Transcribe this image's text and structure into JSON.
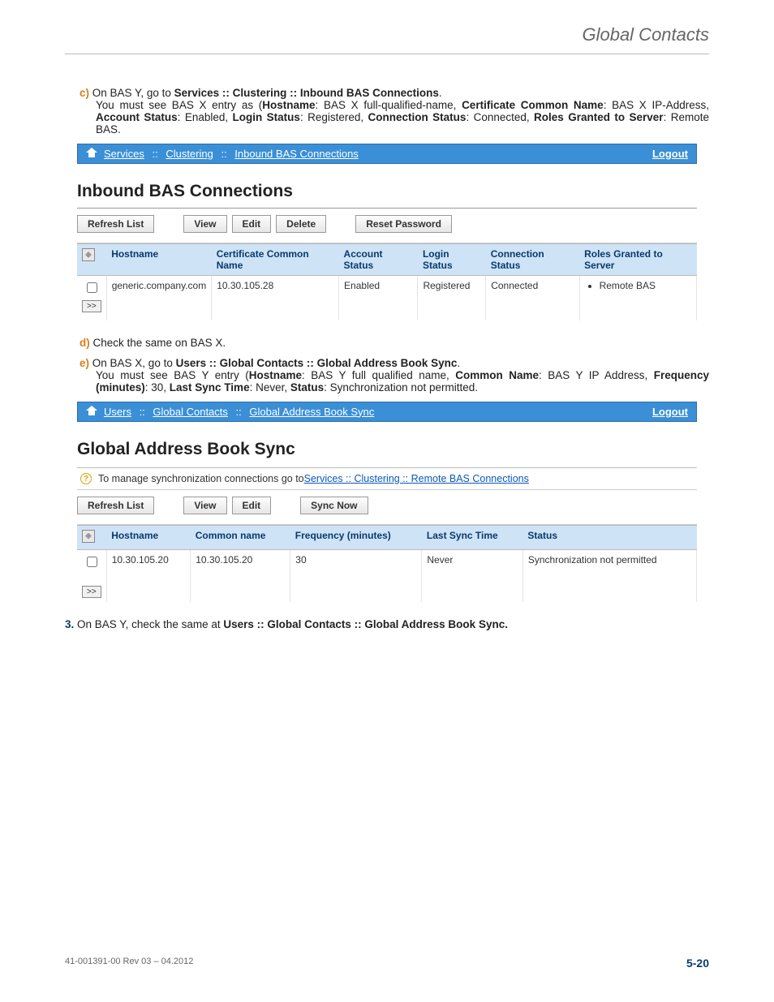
{
  "header_title": "Global Contacts",
  "step_c": {
    "label": "c)",
    "intro_pre": "On BAS Y, go to ",
    "intro_bold": "Services :: Clustering :: Inbound BAS Connections",
    "intro_post": ".",
    "body_parts": [
      "You must see BAS X entry as (",
      {
        "b": "Hostname"
      },
      ": BAS X full-qualified-name, ",
      {
        "b": "Certificate Common Name"
      },
      ": BAS X IP-Address, ",
      {
        "b": "Account Status"
      },
      ": Enabled, ",
      {
        "b": "Login Status"
      },
      ": Registered, ",
      {
        "b": "Connection Status"
      },
      ": Connected, ",
      {
        "b": "Roles Granted to Server"
      },
      ": Remote BAS."
    ]
  },
  "bar1": {
    "crumbs": [
      "Services",
      "Clustering",
      "Inbound BAS Connections"
    ],
    "sep": "::",
    "logout": "Logout"
  },
  "panel1": {
    "title": "Inbound BAS Connections",
    "buttons": [
      "Refresh List",
      "View",
      "Edit",
      "Delete",
      "Reset Password"
    ],
    "columns": [
      "Hostname",
      "Certificate Common Name",
      "Account Status",
      "Login Status",
      "Connection Status",
      "Roles Granted to Server"
    ],
    "rows": [
      {
        "hostname": "generic.company.com",
        "ccn": "10.30.105.28",
        "account_status": "Enabled",
        "login_status": "Registered",
        "connection_status": "Connected",
        "roles": [
          "Remote BAS"
        ]
      }
    ]
  },
  "step_d": {
    "label": "d)",
    "text": "Check the same on BAS X."
  },
  "step_e": {
    "label": "e)",
    "intro_pre": "On BAS X, go to ",
    "intro_bold": "Users :: Global Contacts :: Global Address Book Sync",
    "intro_post": ".",
    "body_parts": [
      "You must see BAS Y entry (",
      {
        "b": "Hostname"
      },
      ": BAS Y full qualified name, ",
      {
        "b": "Common Name"
      },
      ": BAS Y IP Address, ",
      {
        "b": "Frequency (minutes)"
      },
      ": 30, ",
      {
        "b": "Last Sync Time"
      },
      ": Never, ",
      {
        "b": "Status"
      },
      ": Synchronization not permitted."
    ]
  },
  "bar2": {
    "crumbs": [
      "Users",
      "Global Contacts",
      "Global Address Book Sync"
    ],
    "sep": "::",
    "logout": "Logout"
  },
  "panel2": {
    "title": "Global Address Book Sync",
    "info_text": "To manage synchronization connections go to ",
    "info_link": "Services :: Clustering :: Remote BAS Connections",
    "buttons": [
      "Refresh List",
      "View",
      "Edit",
      "Sync Now"
    ],
    "columns": [
      "Hostname",
      "Common name",
      "Frequency (minutes)",
      "Last Sync Time",
      "Status"
    ],
    "rows": [
      {
        "hostname": "10.30.105.20",
        "common_name": "10.30.105.20",
        "frequency": "30",
        "last_sync": "Never",
        "status": "Synchronization not permitted"
      }
    ]
  },
  "step3": {
    "num": "3.",
    "pre": "On BAS Y, check the same at ",
    "bold": "Users :: Global Contacts :: Global Address Book Sync."
  },
  "footer": {
    "left": "41-001391-00 Rev 03 – 04.2012",
    "right": "5-20"
  }
}
